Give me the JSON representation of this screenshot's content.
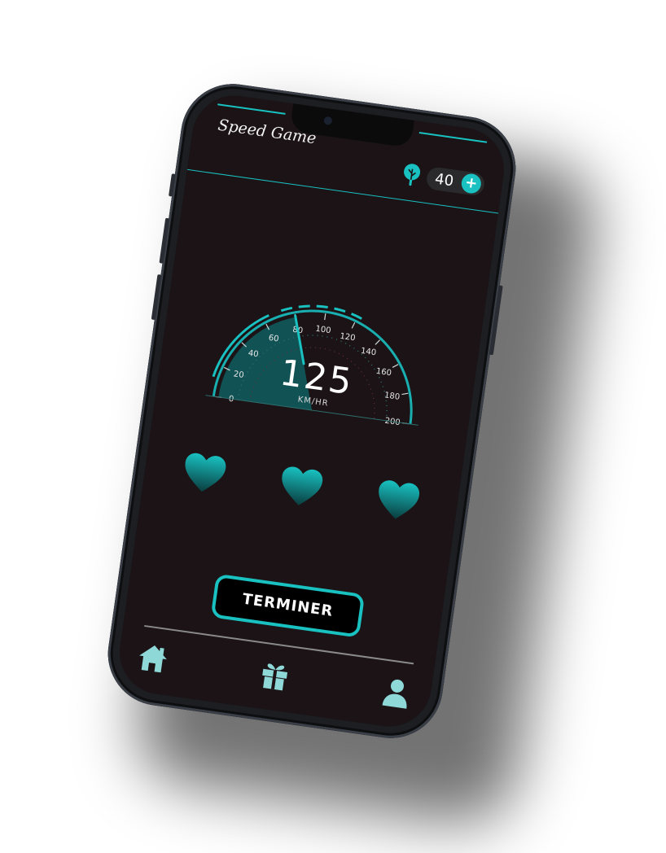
{
  "app": {
    "title": "Speed Game"
  },
  "currency": {
    "icon": "tree-icon",
    "value": "40",
    "add_label": "+"
  },
  "speedometer": {
    "value": "125",
    "unit": "KM/HR",
    "needle_value": 80,
    "max": 200,
    "ticks": [
      "0",
      "20",
      "40",
      "60",
      "80",
      "100",
      "120",
      "140",
      "160",
      "180",
      "200"
    ]
  },
  "lives": {
    "count": 3,
    "icon": "heart-icon"
  },
  "actions": {
    "finish_label": "TERMINER"
  },
  "nav": {
    "items": [
      {
        "name": "home",
        "icon": "home-icon"
      },
      {
        "name": "gifts",
        "icon": "gift-icon"
      },
      {
        "name": "profile",
        "icon": "user-icon"
      }
    ]
  },
  "colors": {
    "accent": "#19c1c1",
    "background": "#1b1315",
    "button_bg": "#000000"
  }
}
